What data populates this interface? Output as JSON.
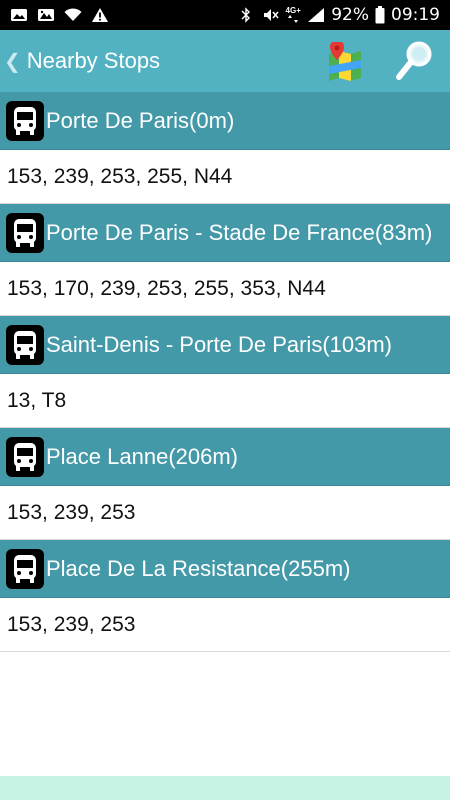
{
  "status_bar": {
    "network_label": "4G+",
    "battery": "92%",
    "time": "09:19"
  },
  "app_bar": {
    "title": "Nearby Stops",
    "back_icon": "chevron-left-icon",
    "map_icon": "map-icon",
    "search_icon": "search-icon"
  },
  "stops": [
    {
      "name": "Porte De Paris(0m)",
      "routes": "153, 239, 253, 255, N44"
    },
    {
      "name": "Porte De Paris - Stade De France(83m)",
      "routes": "153, 170, 239, 253, 255, 353, N44"
    },
    {
      "name": "Saint-Denis - Porte De Paris(103m)",
      "routes": "13, T8"
    },
    {
      "name": "Place Lanne(206m)",
      "routes": "153, 239, 253"
    },
    {
      "name": "Place De La Resistance(255m)",
      "routes": "153, 239, 253"
    }
  ],
  "colors": {
    "app_bar": "#52b2c2",
    "stop_header": "#4499a9",
    "bottom_strip": "#c8f2e4"
  }
}
